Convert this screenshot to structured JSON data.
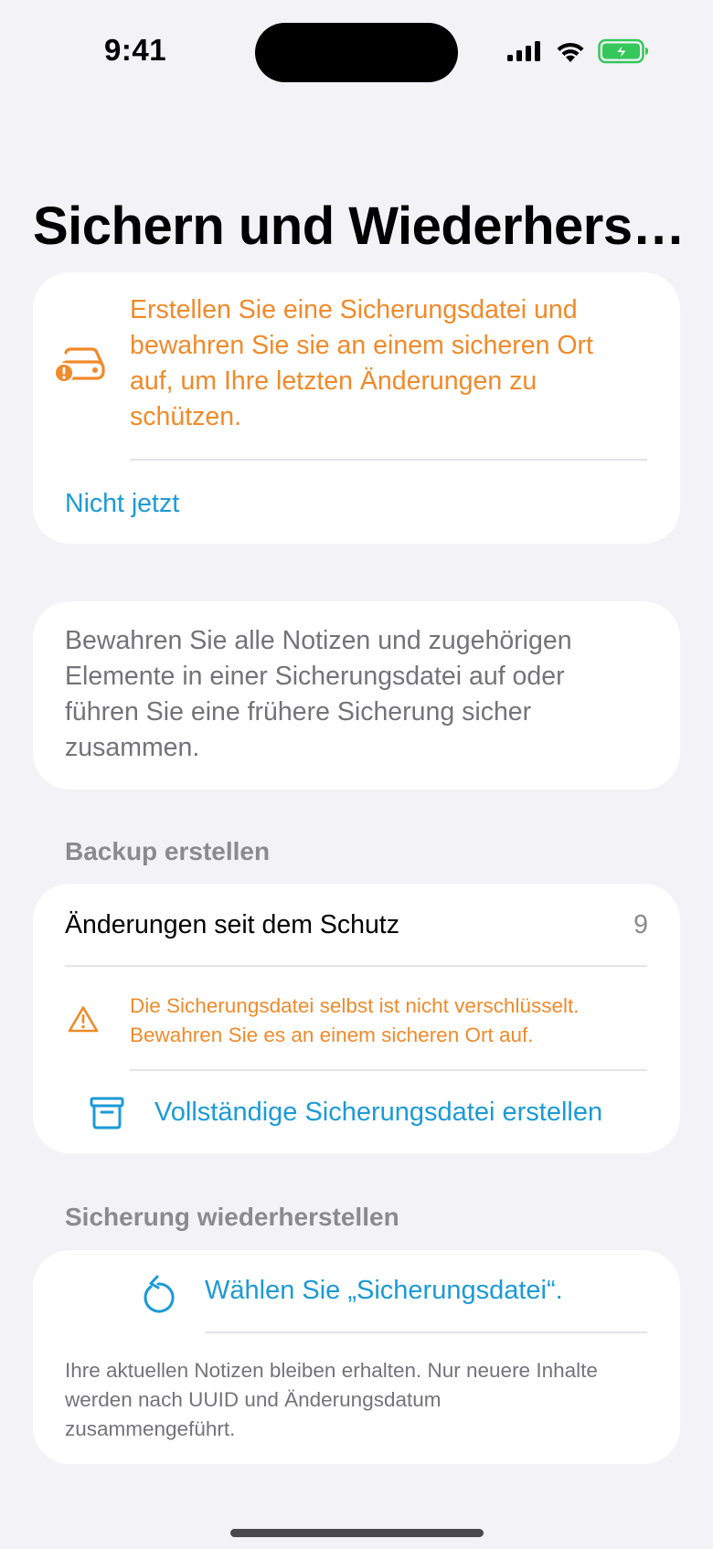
{
  "status_bar": {
    "time": "9:41"
  },
  "title": "Sichern und Wiederhers…",
  "warning_card": {
    "icon": "drive-warning-icon",
    "message": "Erstellen Sie eine Sicherungsdatei und bewahren Sie sie an einem sicheren Ort auf, um Ihre letzten Änderungen zu schützen.",
    "not_now_label": "Nicht jetzt"
  },
  "description": "Bewahren Sie alle Notizen und zugehörigen Elemente in einer Sicherungsdatei auf oder führen Sie eine frühere Sicherung sicher zusammen.",
  "backup_section": {
    "header": "Backup erstellen",
    "changes_label": "Änderungen seit dem Schutz",
    "changes_count": "9",
    "alert_text": "Die Sicherungsdatei selbst ist nicht verschlüsselt. Bewahren Sie es an einem sicheren Ort auf.",
    "create_button": "Vollständige Sicherungsdatei erstellen"
  },
  "restore_section": {
    "header": "Sicherung wiederherstellen",
    "choose_button": "Wählen Sie „Sicherungsdatei“.",
    "note": "Ihre aktuellen Notizen bleiben erhalten. Nur neuere Inhalte werden nach UUID und Änderungsdatum zusammengeführt."
  },
  "colors": {
    "background": "#f2f2f7",
    "accent_blue": "#1b9ad6",
    "warning_orange": "#f08a2a",
    "secondary_text": "#737378",
    "battery_green": "#34c759"
  }
}
